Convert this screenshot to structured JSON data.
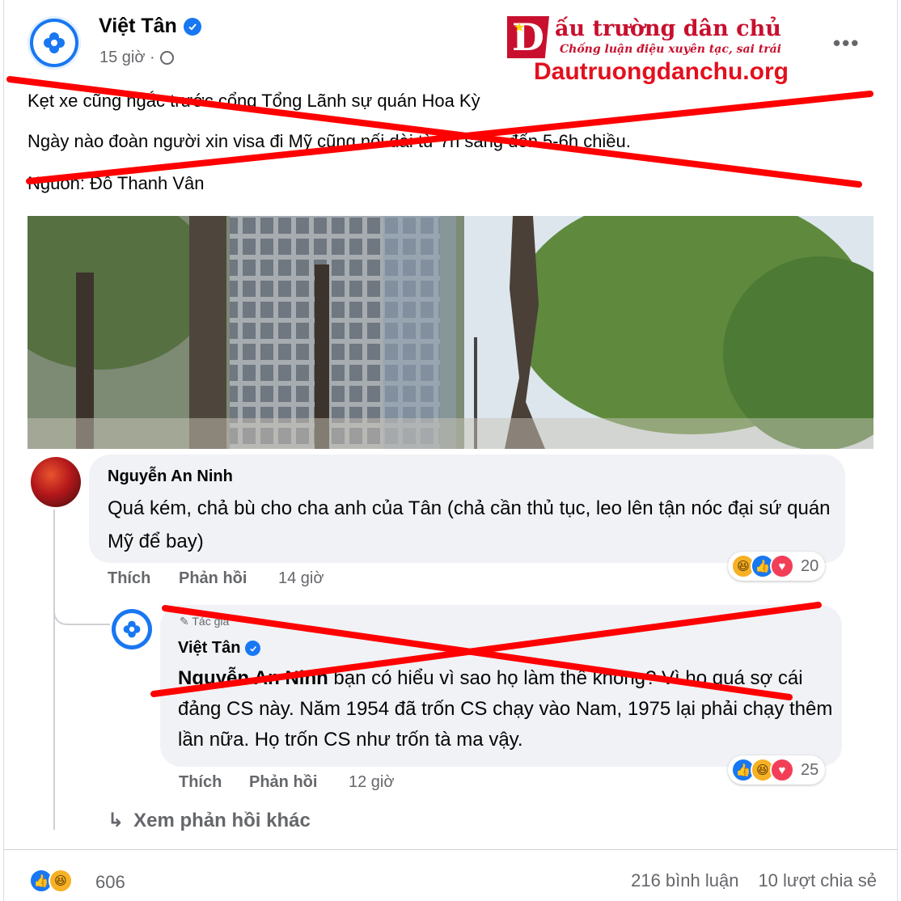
{
  "post": {
    "author": "Việt Tân",
    "time": "15 giờ ·",
    "more_label": "•••",
    "lines": [
      "Kẹt xe cũng ngắc trước cổng Tổng Lãnh sự quán Hoa Kỳ",
      "Ngày nào đoàn người xin visa đi Mỹ cũng nối dài từ 7h sáng đến 5-6h chiều.",
      "Nguồn: Đỗ Thanh Vân"
    ]
  },
  "watermark": {
    "logo_letter": "D",
    "title": "ấu trường dân chủ",
    "subtitle": "Chống luận điệu xuyên tạc, sai trái",
    "url": "Dautruongdanchu.org"
  },
  "comment": {
    "author": "Nguyễn An Ninh",
    "text": "Quá kém, chả bù cho cha anh của Tân (chả cần thủ tục, leo lên tận nóc đại sứ quán Mỹ để bay)",
    "like_label": "Thích",
    "reply_label": "Phản hồi",
    "time": "14 giờ",
    "reaction_count": "20"
  },
  "reply": {
    "badge": "Tác giả",
    "author": "Việt Tân",
    "mention": "Nguyễn An Ninh",
    "text": " bạn có hiểu vì sao họ làm thế không? Vì họ quá sợ cái đảng CS này. Năm 1954 đã trốn CS chạy vào Nam, 1975 lại phải chạy thêm lần nữa. Họ trốn CS như trốn tà ma vậy.",
    "like_label": "Thích",
    "reply_label": "Phản hồi",
    "time": "12 giờ",
    "reaction_count": "25"
  },
  "more_replies": "Xem phản hồi khác",
  "footer": {
    "reaction_count": "606",
    "comments": "216 bình luận",
    "shares": "10 lượt chia sẻ"
  },
  "colors": {
    "facebook_blue": "#1877f2",
    "watermark_red": "#c8102e",
    "cross_red": "#ff0000",
    "bubble_gray": "#f0f2f5"
  }
}
